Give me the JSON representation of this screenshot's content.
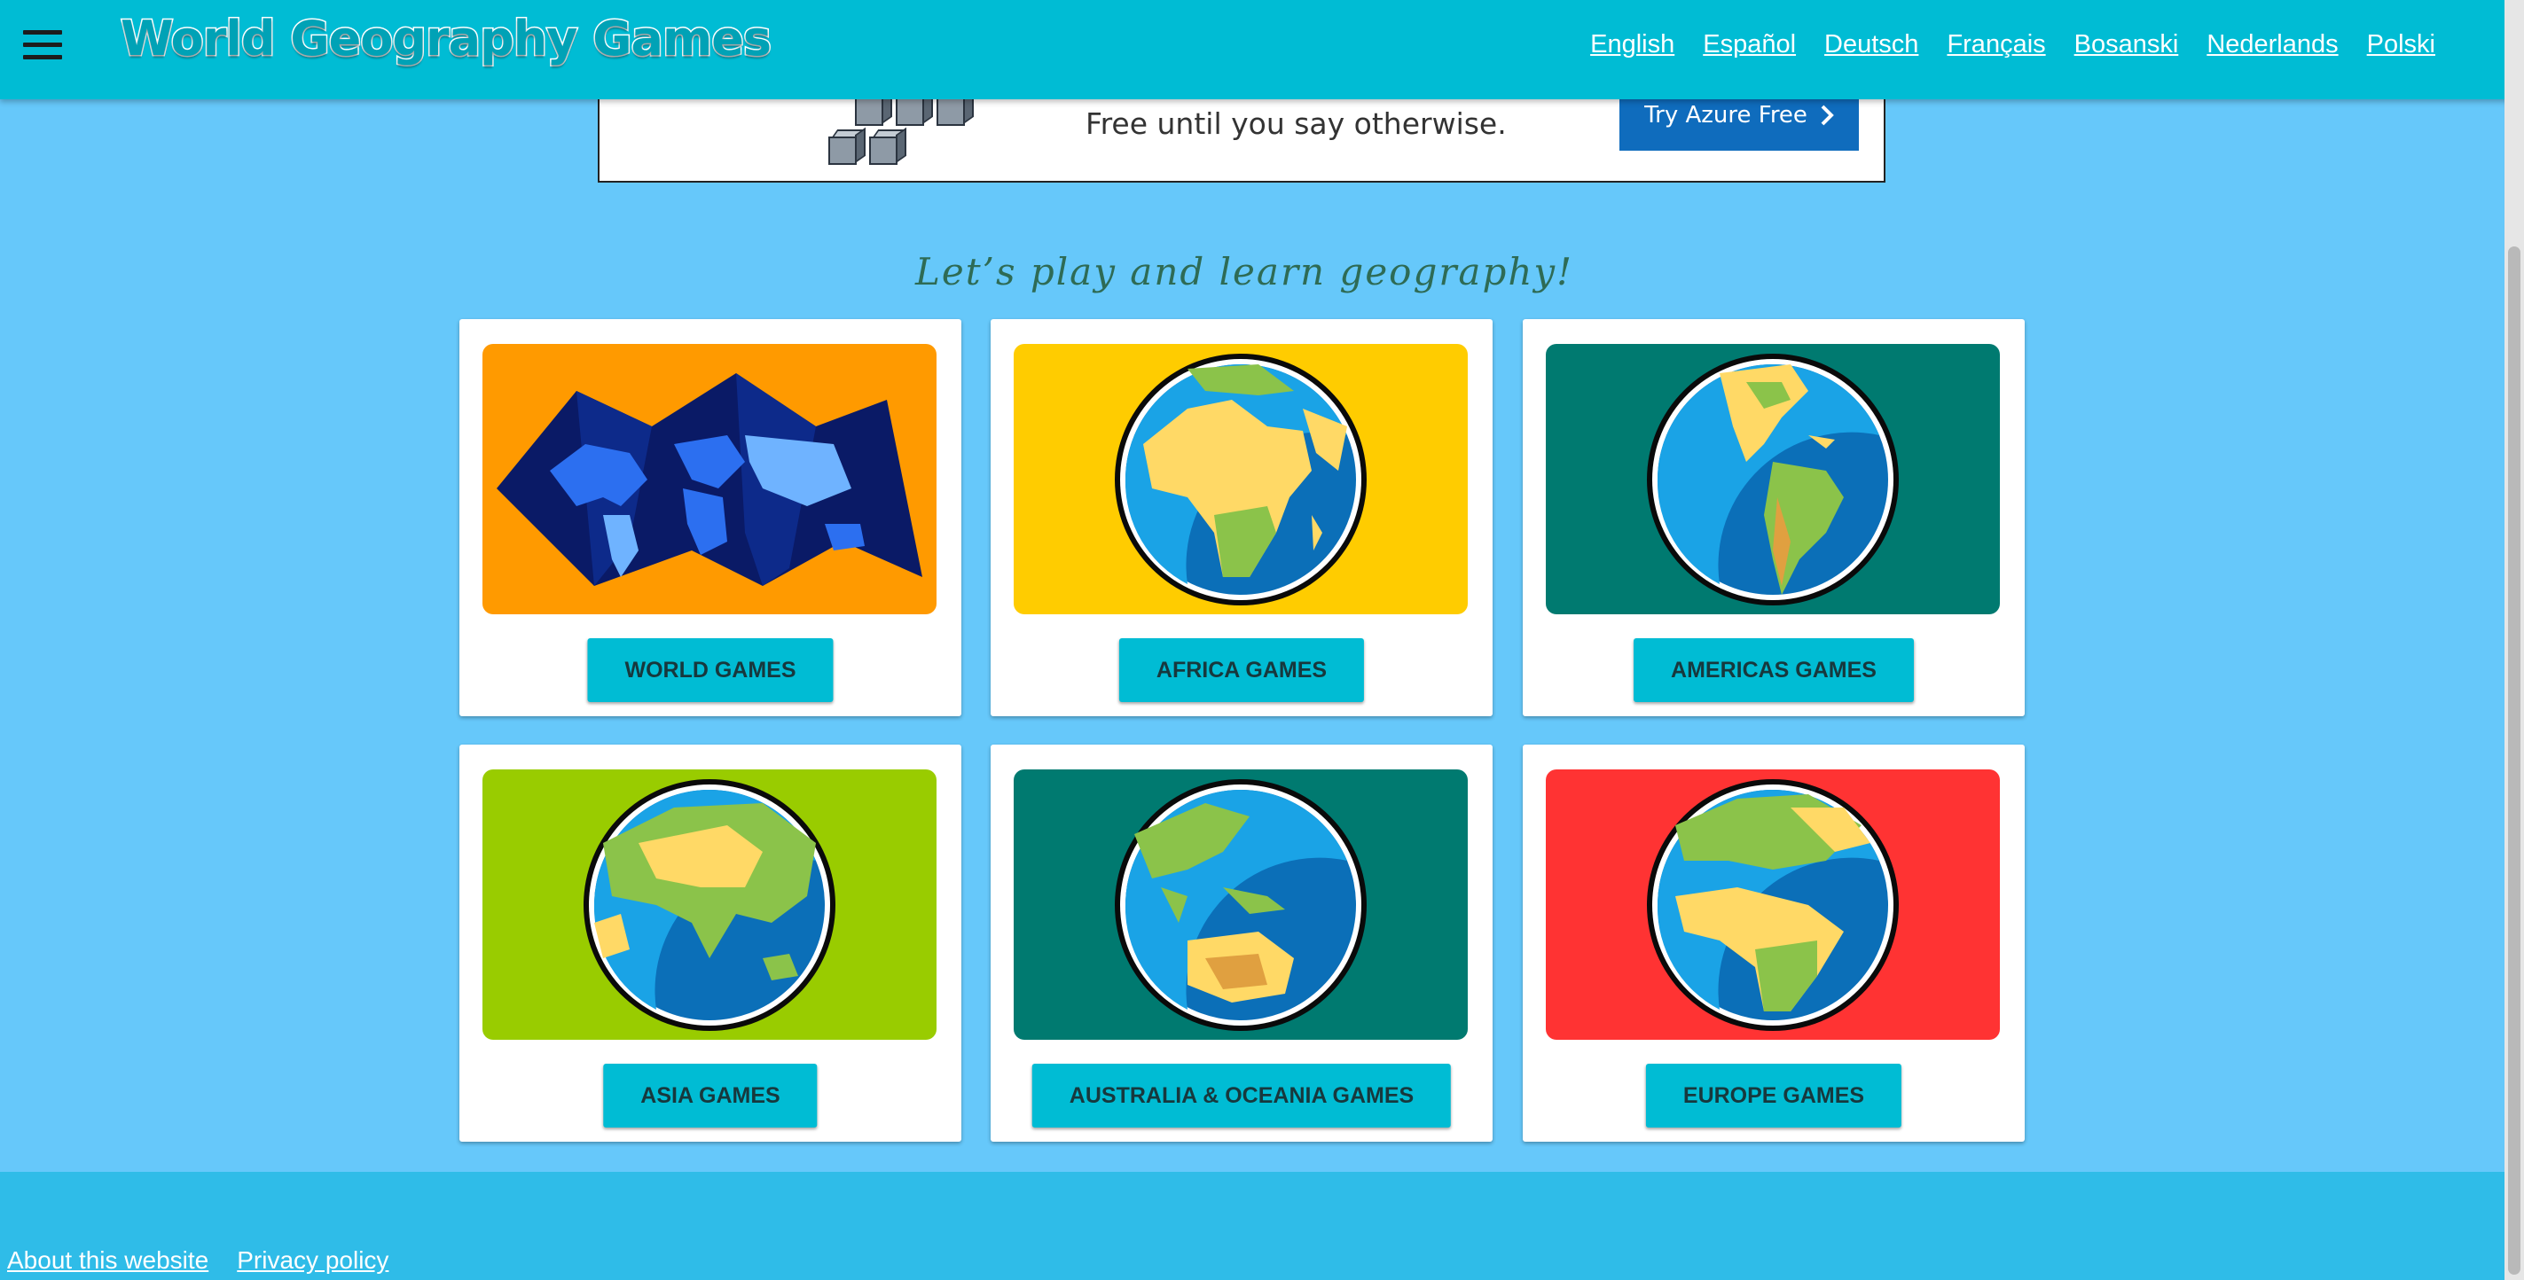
{
  "header": {
    "logo_text": "World Geography Games",
    "languages": [
      "English",
      "Español",
      "Deutsch",
      "Français",
      "Bosanski",
      "Nederlands",
      "Polski"
    ]
  },
  "ad": {
    "text": "Free until you say otherwise.",
    "button_label": "Try Azure Free"
  },
  "tagline": "Let’s play and learn geography!",
  "cards": [
    {
      "label": "WORLD GAMES",
      "bg": "#ff9a00",
      "icon": "world-map-icon"
    },
    {
      "label": "AFRICA GAMES",
      "bg": "#ffcc00",
      "icon": "globe-africa-icon"
    },
    {
      "label": "AMERICAS GAMES",
      "bg": "#007a70",
      "icon": "globe-americas-icon"
    },
    {
      "label": "ASIA GAMES",
      "bg": "#99cc00",
      "icon": "globe-asia-icon"
    },
    {
      "label": "AUSTRALIA & OCEANIA GAMES",
      "bg": "#007a70",
      "icon": "globe-oceania-icon"
    },
    {
      "label": "EUROPE GAMES",
      "bg": "#ff3333",
      "icon": "globe-europe-icon"
    }
  ],
  "footer": {
    "links": [
      "About this website",
      "Privacy policy"
    ]
  },
  "colors": {
    "page_bg": "#66c8fa",
    "header_bg": "#00bcd4",
    "button_bg": "#00bcd4",
    "footer_bg": "#2fbce8"
  }
}
